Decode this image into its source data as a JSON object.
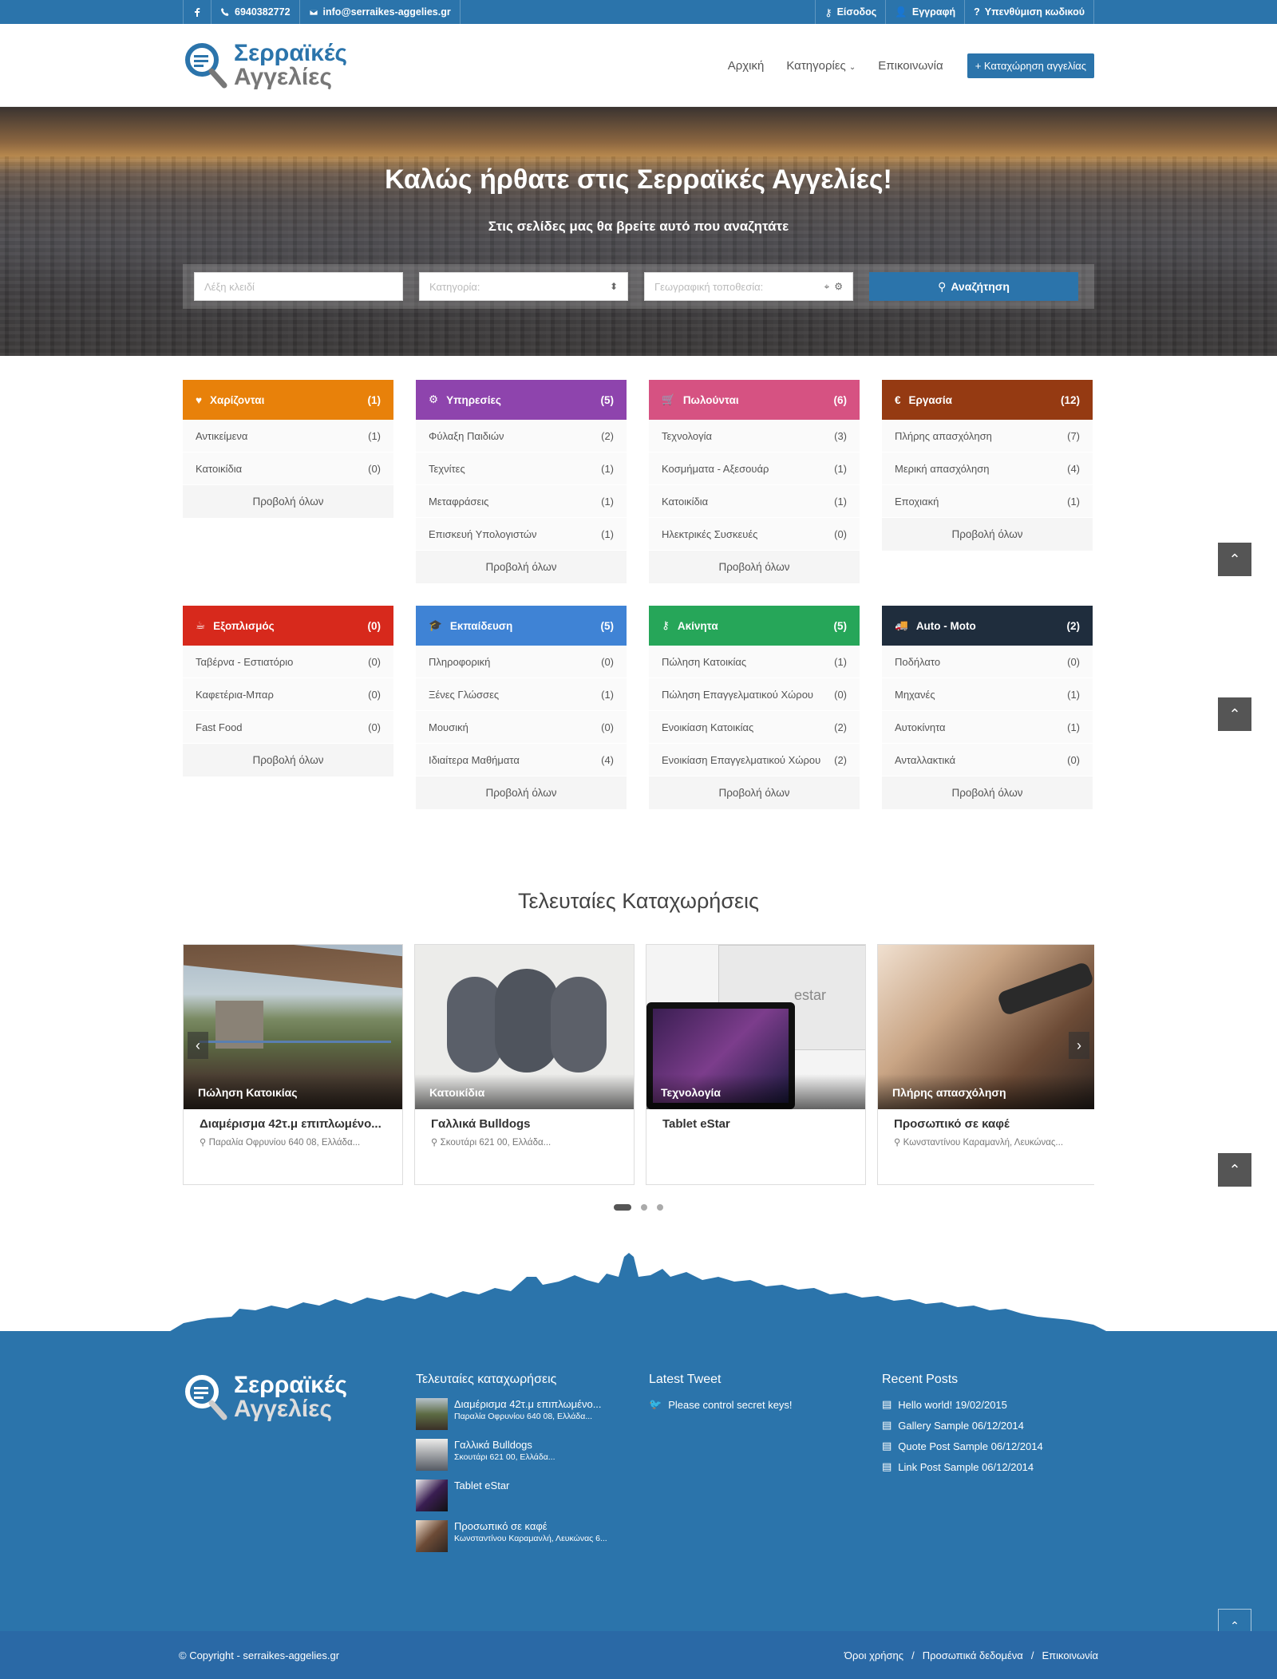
{
  "topbar": {
    "phone": "6940382772",
    "email": "info@serraikes-aggelies.gr",
    "login": "Είσοδος",
    "register": "Εγγραφή",
    "remind": "Υπενθύμιση κωδικού"
  },
  "logo": {
    "line1": "Σερραϊκές",
    "line2": "Αγγελίες"
  },
  "nav": {
    "home": "Αρχική",
    "categories": "Κατηγορίες",
    "contact": "Επικοινωνία",
    "cta": "+ Καταχώρηση αγγελίας"
  },
  "hero": {
    "title": "Καλώς ήρθατε στις Σερραϊκές Αγγελίες!",
    "subtitle": "Στις σελίδες μας θα βρείτε αυτό που αναζητάτε"
  },
  "search": {
    "keyword_placeholder": "Λέξη κλειδί",
    "category_placeholder": "Κατηγορία:",
    "location_placeholder": "Γεωγραφική τοποθεσία:",
    "button": "Αναζήτηση"
  },
  "categories": [
    {
      "name": "Χαρίζονται",
      "count": "(1)",
      "color": "#e8810a",
      "icon": "heart-icon",
      "items": [
        {
          "label": "Αντικείμενα",
          "count": "(1)"
        },
        {
          "label": "Κατοικίδια",
          "count": "(0)"
        }
      ],
      "all": "Προβολή όλων"
    },
    {
      "name": "Υπηρεσίες",
      "count": "(5)",
      "color": "#8e44ad",
      "icon": "gear-icon",
      "items": [
        {
          "label": "Φύλαξη Παιδιών",
          "count": "(2)"
        },
        {
          "label": "Τεχνίτες",
          "count": "(1)"
        },
        {
          "label": "Μεταφράσεις",
          "count": "(1)"
        },
        {
          "label": "Επισκευή Υπολογιστών",
          "count": "(1)"
        }
      ],
      "all": "Προβολή όλων"
    },
    {
      "name": "Πωλούνται",
      "count": "(6)",
      "color": "#d65282",
      "icon": "cart-icon",
      "items": [
        {
          "label": "Τεχνολογία",
          "count": "(3)"
        },
        {
          "label": "Κοσμήματα - Αξεσουάρ",
          "count": "(1)"
        },
        {
          "label": "Κατοικίδια",
          "count": "(1)"
        },
        {
          "label": "Ηλεκτρικές Συσκευές",
          "count": "(0)"
        }
      ],
      "all": "Προβολή όλων"
    },
    {
      "name": "Εργασία",
      "count": "(12)",
      "color": "#953a12",
      "icon": "euro-icon",
      "items": [
        {
          "label": "Πλήρης απασχόληση",
          "count": "(7)"
        },
        {
          "label": "Μερική απασχόληση",
          "count": "(4)"
        },
        {
          "label": "Εποχιακή",
          "count": "(1)"
        }
      ],
      "all": "Προβολή όλων"
    },
    {
      "name": "Εξοπλισμός",
      "count": "(0)",
      "color": "#d7291c",
      "icon": "coffee-icon",
      "items": [
        {
          "label": "Ταβέρνα - Εστιατόριο",
          "count": "(0)"
        },
        {
          "label": "Καφετέρια-Μπαρ",
          "count": "(0)"
        },
        {
          "label": "Fast Food",
          "count": "(0)"
        }
      ],
      "all": "Προβολή όλων"
    },
    {
      "name": "Εκπαίδευση",
      "count": "(5)",
      "color": "#3f83d5",
      "icon": "graduation-cap-icon",
      "items": [
        {
          "label": "Πληροφορική",
          "count": "(0)"
        },
        {
          "label": "Ξένες Γλώσσες",
          "count": "(1)"
        },
        {
          "label": "Μουσική",
          "count": "(0)"
        },
        {
          "label": "Ιδιαίτερα Μαθήματα",
          "count": "(4)"
        }
      ],
      "all": "Προβολή όλων"
    },
    {
      "name": "Ακίνητα",
      "count": "(5)",
      "color": "#26a659",
      "icon": "key-icon",
      "items": [
        {
          "label": "Πώληση Κατοικίας",
          "count": "(1)"
        },
        {
          "label": "Πώληση Επαγγελματικού Χώρου",
          "count": "(0)"
        },
        {
          "label": "Ενοικίαση Κατοικίας",
          "count": "(2)"
        },
        {
          "label": "Ενοικίαση Επαγγελματικού Χώρου",
          "count": "(2)"
        }
      ],
      "all": "Προβολή όλων"
    },
    {
      "name": "Auto - Moto",
      "count": "(2)",
      "color": "#1f2d3d",
      "icon": "truck-icon",
      "items": [
        {
          "label": "Ποδήλατο",
          "count": "(0)"
        },
        {
          "label": "Μηχανές",
          "count": "(1)"
        },
        {
          "label": "Αυτοκίνητα",
          "count": "(1)"
        },
        {
          "label": "Ανταλλακτικά",
          "count": "(0)"
        }
      ],
      "all": "Προβολή όλων"
    }
  ],
  "latest": {
    "title": "Τελευταίες Καταχωρήσεις",
    "cards": [
      {
        "cat": "Πώληση Κατοικίας",
        "title": "Διαμέρισμα 42τ.μ επιπλωμένο...",
        "loc": "Παραλία Οφρυνίου 640 08, Ελλάδα..."
      },
      {
        "cat": "Κατοικίδια",
        "title": "Γαλλικά Bulldogs",
        "loc": "Σκουτάρι 621 00, Ελλάδα..."
      },
      {
        "cat": "Τεχνολογία",
        "title": "Tablet eStar",
        "loc": ""
      },
      {
        "cat": "Πλήρης απασχόληση",
        "title": "Προσωπικό σε καφέ",
        "loc": "Κωνσταντίνου Καραμανλή, Λευκώνας..."
      }
    ],
    "tablet_brand": "estar"
  },
  "footer": {
    "posts_title": "Τελευταίες καταχωρήσεις",
    "posts": [
      {
        "t": "Διαμέρισμα 42τ.μ επιπλωμένο...",
        "s": "Παραλία Οφρυνίου 640 08, Ελλάδα..."
      },
      {
        "t": "Γαλλικά Bulldogs",
        "s": "Σκουτάρι 621 00, Ελλάδα..."
      },
      {
        "t": "Tablet eStar",
        "s": ""
      },
      {
        "t": "Προσωπικό σε καφέ",
        "s": "Κωνσταντίνου Καραμανλή, Λευκώνας 6..."
      }
    ],
    "tweet_title": "Latest Tweet",
    "tweet": "Please control secret keys!",
    "recent_title": "Recent Posts",
    "recent": [
      "Hello world! 19/02/2015",
      "Gallery Sample 06/12/2014",
      "Quote Post Sample 06/12/2014",
      "Link Post Sample 06/12/2014"
    ]
  },
  "bottom": {
    "copyright": "© Copyright - serraikes-aggelies.gr",
    "terms": "Όροι χρήσης",
    "privacy": "Προσωπικά δεδομένα",
    "contact": "Επικοινωνία",
    "sep": "/"
  },
  "colors": {
    "brand": "#2b74ab"
  }
}
